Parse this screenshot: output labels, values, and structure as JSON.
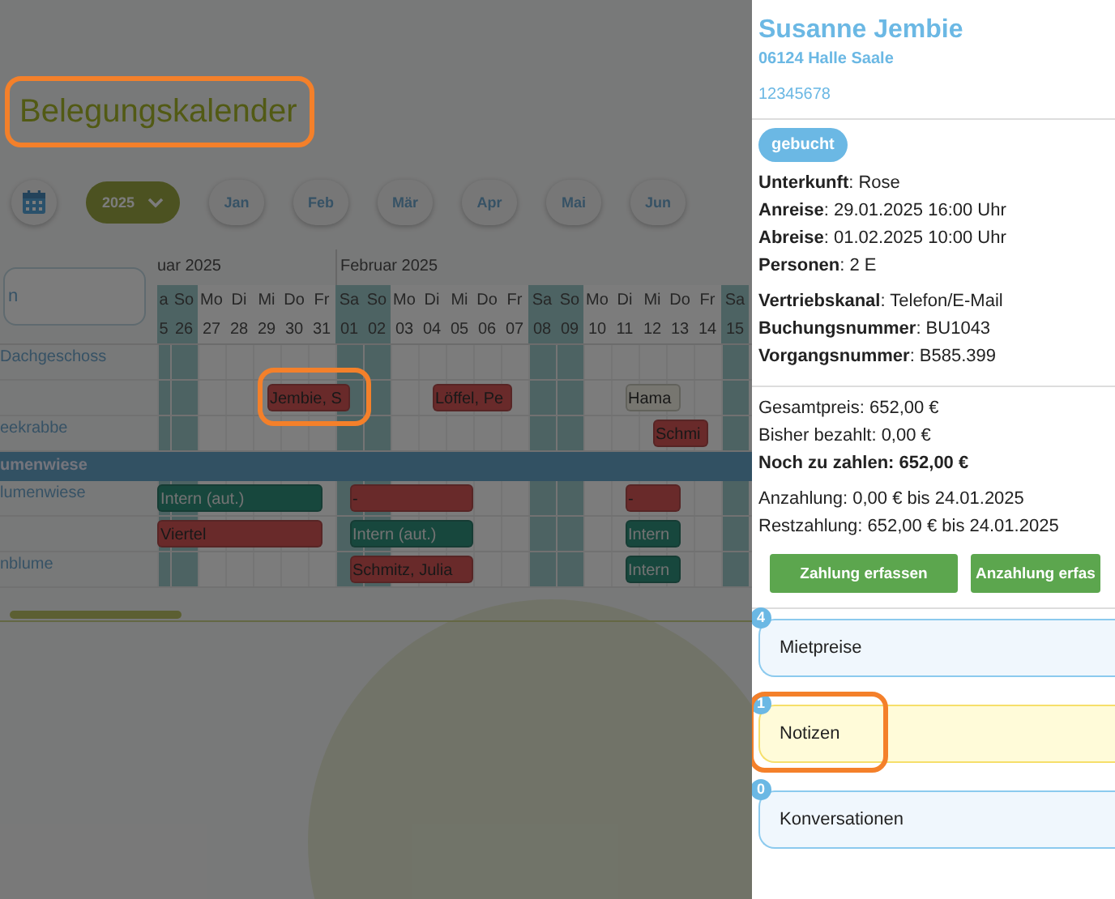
{
  "calendar": {
    "title": "Belegungskalender",
    "year_picker": {
      "value": "2025"
    },
    "months": [
      {
        "label": "Jan"
      },
      {
        "label": "Feb"
      },
      {
        "label": "Mär"
      },
      {
        "label": "Apr"
      },
      {
        "label": "Mai"
      },
      {
        "label": "Jun"
      }
    ],
    "search": {
      "placeholder": "n"
    },
    "month_headers": [
      "uar 2025",
      "Februar 2025"
    ],
    "days": [
      {
        "name": "a",
        "num": "5",
        "weekend": true
      },
      {
        "name": "So",
        "num": "26",
        "weekend": true
      },
      {
        "name": "Mo",
        "num": "27",
        "weekend": false
      },
      {
        "name": "Di",
        "num": "28",
        "weekend": false
      },
      {
        "name": "Mi",
        "num": "29",
        "weekend": false
      },
      {
        "name": "Do",
        "num": "30",
        "weekend": false
      },
      {
        "name": "Fr",
        "num": "31",
        "weekend": false
      },
      {
        "name": "Sa",
        "num": "01",
        "weekend": true
      },
      {
        "name": "So",
        "num": "02",
        "weekend": true
      },
      {
        "name": "Mo",
        "num": "03",
        "weekend": false
      },
      {
        "name": "Di",
        "num": "04",
        "weekend": false
      },
      {
        "name": "Mi",
        "num": "05",
        "weekend": false
      },
      {
        "name": "Do",
        "num": "06",
        "weekend": false
      },
      {
        "name": "Fr",
        "num": "07",
        "weekend": false
      },
      {
        "name": "Sa",
        "num": "08",
        "weekend": true
      },
      {
        "name": "So",
        "num": "09",
        "weekend": true
      },
      {
        "name": "Mo",
        "num": "10",
        "weekend": false
      },
      {
        "name": "Di",
        "num": "11",
        "weekend": false
      },
      {
        "name": "Mi",
        "num": "12",
        "weekend": false
      },
      {
        "name": "Do",
        "num": "13",
        "weekend": false
      },
      {
        "name": "Fr",
        "num": "14",
        "weekend": false
      },
      {
        "name": "Sa",
        "num": "15",
        "weekend": true
      }
    ],
    "rows": [
      {
        "kind": "room",
        "label": "Dachgeschoss",
        "bookings": []
      },
      {
        "kind": "room",
        "bookings": [
          {
            "label": "Jembie, S",
            "kind": "booked"
          },
          {
            "label": "Löffel, Pe",
            "kind": "booked"
          },
          {
            "label": "Hama",
            "kind": "option"
          }
        ]
      },
      {
        "kind": "room",
        "label": "eekrabbe",
        "bookings": [
          {
            "label": "Schmi",
            "kind": "booked"
          }
        ]
      },
      {
        "kind": "group",
        "label": "umenwiese"
      },
      {
        "kind": "room",
        "label": "lumenwiese",
        "bookings": [
          {
            "label": "Intern (aut.)",
            "kind": "internal"
          },
          {
            "label": "-",
            "kind": "booked"
          },
          {
            "label": "-",
            "kind": "booked"
          }
        ]
      },
      {
        "kind": "room",
        "bookings": [
          {
            "label": "Viertel",
            "kind": "booked"
          },
          {
            "label": "Intern (aut.)",
            "kind": "internal"
          },
          {
            "label": "Intern",
            "kind": "internal"
          }
        ]
      },
      {
        "kind": "room",
        "label": "nblume",
        "bookings": [
          {
            "label": "Schmitz, Julia",
            "kind": "booked"
          },
          {
            "label": "Intern",
            "kind": "internal"
          }
        ]
      }
    ]
  },
  "guest": {
    "name": "Susanne Jembie",
    "city": "06124 Halle Saale",
    "phone": "12345678",
    "status": "gebucht",
    "details": [
      "**Unterkunft**: Rose",
      "**Anreise**: 29.01.2025 16:00 Uhr",
      "**Abreise**: 01.02.2025 10:00 Uhr",
      "**Personen**: 2 E"
    ],
    "booking_info": [
      "**Vertriebskanal**: Telefon/E-Mail",
      "**Buchungsnummer**: BU1043",
      "**Vorgangsnummer**: B585.399"
    ],
    "prices": [
      {
        "text": "Gesamtpreis: 652,00 €",
        "emphasis": false
      },
      {
        "text": "Bisher bezahlt: 0,00 €",
        "emphasis": false
      },
      {
        "text": "Noch zu zahlen: 652,00 €",
        "emphasis": true
      }
    ],
    "payments": [
      "Anzahlung: 0,00 € bis 24.01.2025",
      "Restzahlung: 652,00 € bis 24.01.2025"
    ],
    "buttons": [
      "Zahlung erfassen",
      "Anzahlung erfas"
    ],
    "sections": [
      {
        "label": "Mietpreise",
        "count": "4",
        "kind": "normal"
      },
      {
        "label": "Notizen",
        "count": "1",
        "kind": "note"
      },
      {
        "label": "Konversationen",
        "count": "0",
        "kind": "normal"
      }
    ]
  }
}
